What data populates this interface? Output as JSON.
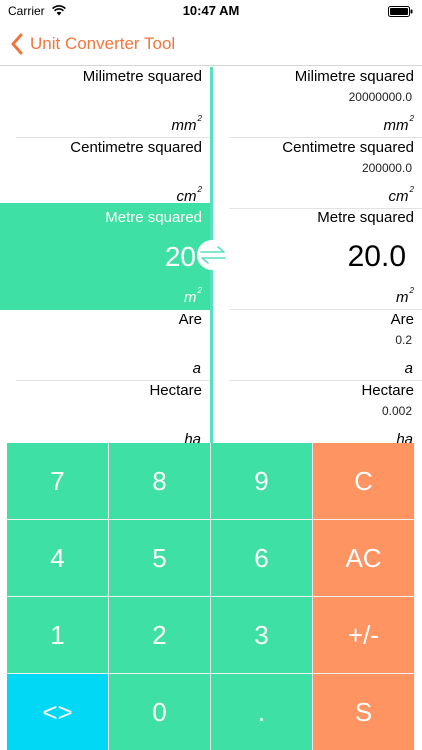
{
  "status_bar": {
    "carrier": "Carrier",
    "time": "10:47 AM"
  },
  "nav": {
    "back_label": "Unit Converter Tool"
  },
  "from_units": [
    {
      "name": "Milimetre squared",
      "symbol": "mm",
      "exp": "2"
    },
    {
      "name": "Centimetre squared",
      "symbol": "cm",
      "exp": "2"
    },
    {
      "name": "Metre squared",
      "symbol": "m",
      "exp": "2",
      "input": "20",
      "selected": true
    },
    {
      "name": "Are",
      "symbol": "a",
      "exp": ""
    },
    {
      "name": "Hectare",
      "symbol": "ha",
      "exp": ""
    }
  ],
  "to_units": [
    {
      "name": "Milimetre squared",
      "value": "20000000.0",
      "symbol": "mm",
      "exp": "2"
    },
    {
      "name": "Centimetre squared",
      "value": "200000.0",
      "symbol": "cm",
      "exp": "2"
    },
    {
      "name": "Metre squared",
      "value": "20.0",
      "symbol": "m",
      "exp": "2",
      "selected": true
    },
    {
      "name": "Are",
      "value": "0.2",
      "symbol": "a",
      "exp": ""
    },
    {
      "name": "Hectare",
      "value": "0.002",
      "symbol": "ha",
      "exp": ""
    }
  ],
  "keypad": {
    "keys": [
      "7",
      "8",
      "9",
      "C",
      "4",
      "5",
      "6",
      "AC",
      "1",
      "2",
      "3",
      "+/-",
      "<>",
      "0",
      ".",
      "S"
    ]
  },
  "colors": {
    "accent": "#f2763b",
    "green": "#3fe0a5",
    "orange": "#fe9462",
    "cyan": "#00d8f6",
    "divider": "#58dfc0"
  }
}
